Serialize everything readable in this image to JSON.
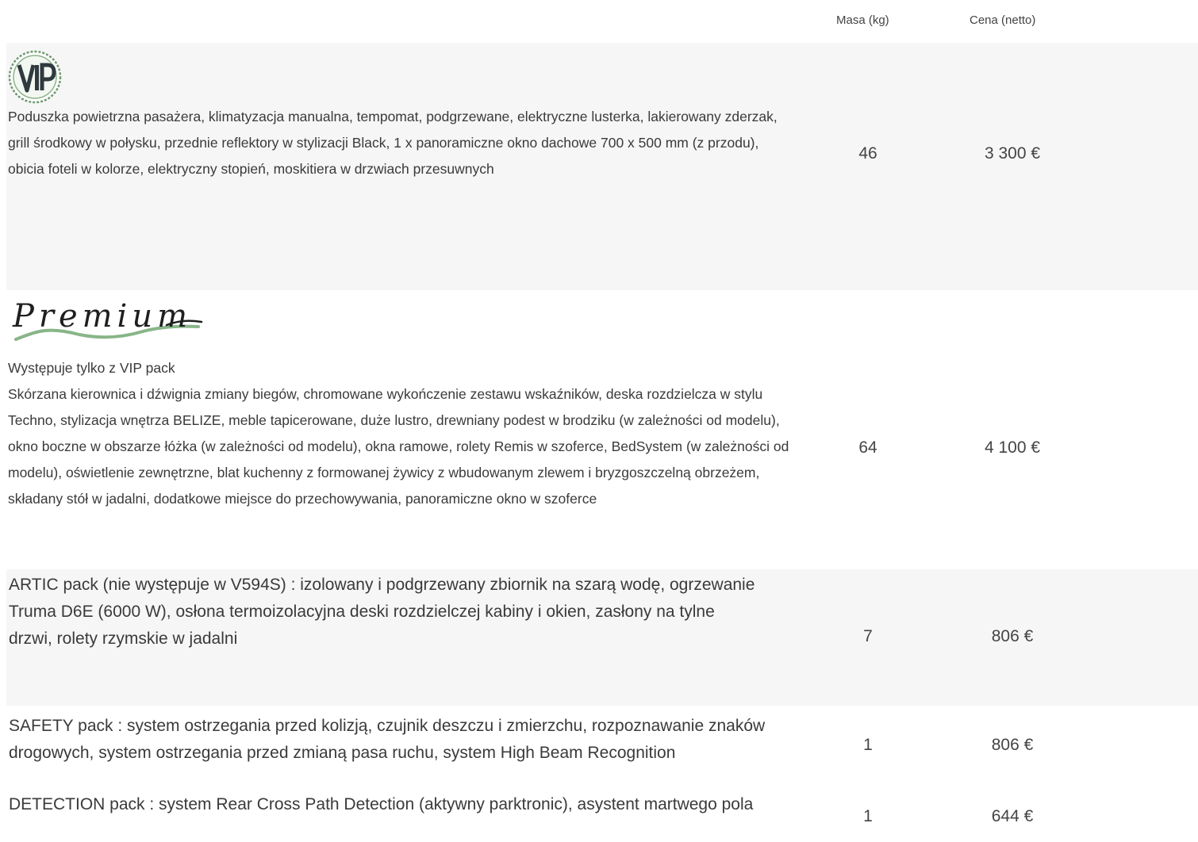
{
  "header": {
    "mass": "Masa (kg)",
    "price": "Cena (netto)"
  },
  "colors": {
    "row_bg": "#f6f6f6",
    "text": "#333333"
  },
  "rows": [
    {
      "logo": "VIP",
      "note": "",
      "desc": "Poduszka powietrzna pasażera, klimatyzacja manualna, tempomat, podgrzewane, elektryczne lusterka, lakierowany zderzak, grill środkowy w połysku, przednie reflektory w stylizacji Black, 1 x panoramiczne okno dachowe 700 x 500 mm (z przodu), obicia foteli w kolorze, elektryczny stopień, moskitiera w drzwiach przesuwnych",
      "mass": "46",
      "price": "3 300 €"
    },
    {
      "logo": "Premium",
      "note": "Występuje tylko z VIP pack",
      "desc": "Skórzana kierownica i dźwignia zmiany biegów, chromowane wykończenie zestawu wskaźników, deska rozdzielcza w stylu Techno, stylizacja wnętrza BELIZE, meble tapicerowane, duże lustro, drewniany podest w brodziku (w zależności od modelu), okno boczne w obszarze łóżka (w zależności od modelu), okna ramowe, rolety Remis w szoferce, BedSystem (w zależności od modelu), oświetlenie zewnętrzne, blat kuchenny z formowanej żywicy z wbudowanym zlewem i bryzgoszczelną obrzeżem, składany stół w jadalni, dodatkowe miejsce do przechowywania, panoramiczne okno w szoferce",
      "mass": "64",
      "price": "4 100 €"
    },
    {
      "desc": "ARTIC pack (nie występuje w V594S) : izolowany i podgrzewany zbiornik na szarą wodę, ogrzewanie Truma D6E (6000 W), osłona termoizolacyjna deski rozdzielczej kabiny i okien, zasłony na tylne drzwi, rolety rzymskie w jadalni",
      "mass": "7",
      "price": "806 €"
    },
    {
      "desc": "SAFETY pack : system ostrzegania przed kolizją, czujnik deszczu i zmierzchu, rozpoznawanie znaków drogowych, system ostrzegania przed zmianą pasa ruchu, system High Beam Recognition",
      "mass": "1",
      "price": "806 €"
    },
    {
      "desc": "DETECTION pack : system Rear Cross Path Detection (aktywny parktronic), asystent martwego pola",
      "mass": "1",
      "price": "644 €"
    }
  ]
}
